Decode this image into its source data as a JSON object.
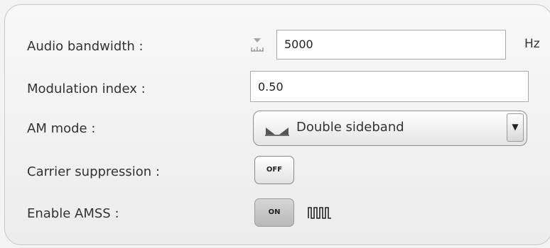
{
  "fields": {
    "audio_bandwidth": {
      "label": "Audio bandwidth :",
      "value": "5000",
      "unit": "Hz",
      "icon": "spin-scale-icon"
    },
    "modulation_index": {
      "label": "Modulation index :",
      "value": "0.50"
    },
    "am_mode": {
      "label": "AM mode :",
      "selected": "Double sideband",
      "icon": "double-sideband-icon",
      "arrow": "▼"
    },
    "carrier_suppression": {
      "label": "Carrier suppression :",
      "state": "OFF"
    },
    "enable_amss": {
      "label": "Enable AMSS :",
      "state": "ON",
      "icon": "pulse-train-icon"
    }
  }
}
